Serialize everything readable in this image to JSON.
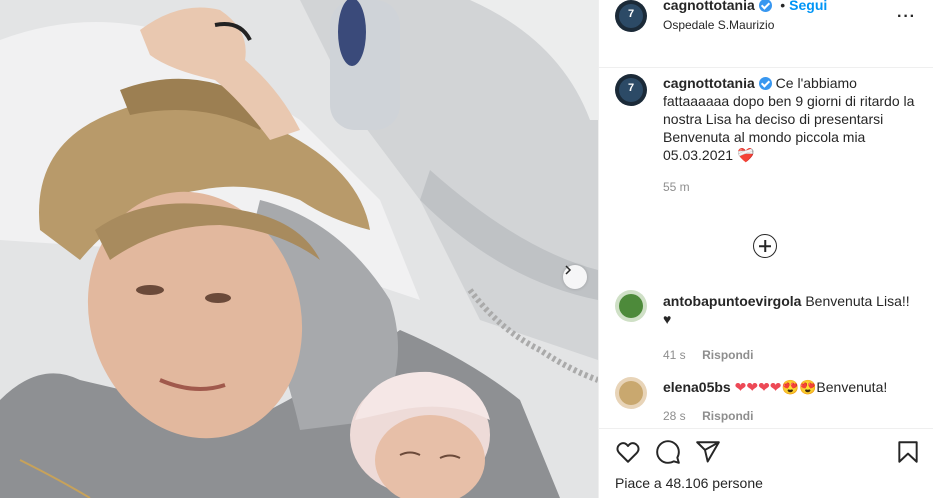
{
  "header": {
    "username": "cagnottotania",
    "follow_label": "Segui",
    "dot": "•",
    "location": "Ospedale S.Maurizio",
    "more_label": "···"
  },
  "caption": {
    "username": "cagnottotania",
    "line1": "Ce l'abbiamo fattaaaaaa⁣⁣⁣ dopo ben 9 giorni di ritardo la nostra Lisa ha deciso di presentarsi ⁣⁣",
    "line2": "Benvenuta al mondo piccola mia",
    "line3": "05.03.2021",
    "line3_emoji": "❤️‍🩹",
    "time": "55 m"
  },
  "comments": [
    {
      "username": "antobapuntoevirgola",
      "text": "Benvenuta Lisa!!",
      "emoji": "♥",
      "time": "41 s",
      "reply": "Rispondi"
    },
    {
      "username": "elena05bs",
      "emoji": "❤❤❤❤😍😍",
      "text": "Benvenuta!",
      "time": "28 s",
      "reply": "Rispondi"
    }
  ],
  "likes": {
    "label": "Piace a 48.106 persone"
  },
  "colors": {
    "accent": "#0095f6",
    "verified": "#3897f0",
    "muted": "#8e8e8e",
    "text": "#262626",
    "heart": "#ed4956"
  },
  "icons": {
    "like": "heart-icon",
    "comment": "comment-icon",
    "share": "send-icon",
    "save": "bookmark-icon",
    "next": "chevron-right-icon",
    "load_more": "plus-circle-icon"
  }
}
